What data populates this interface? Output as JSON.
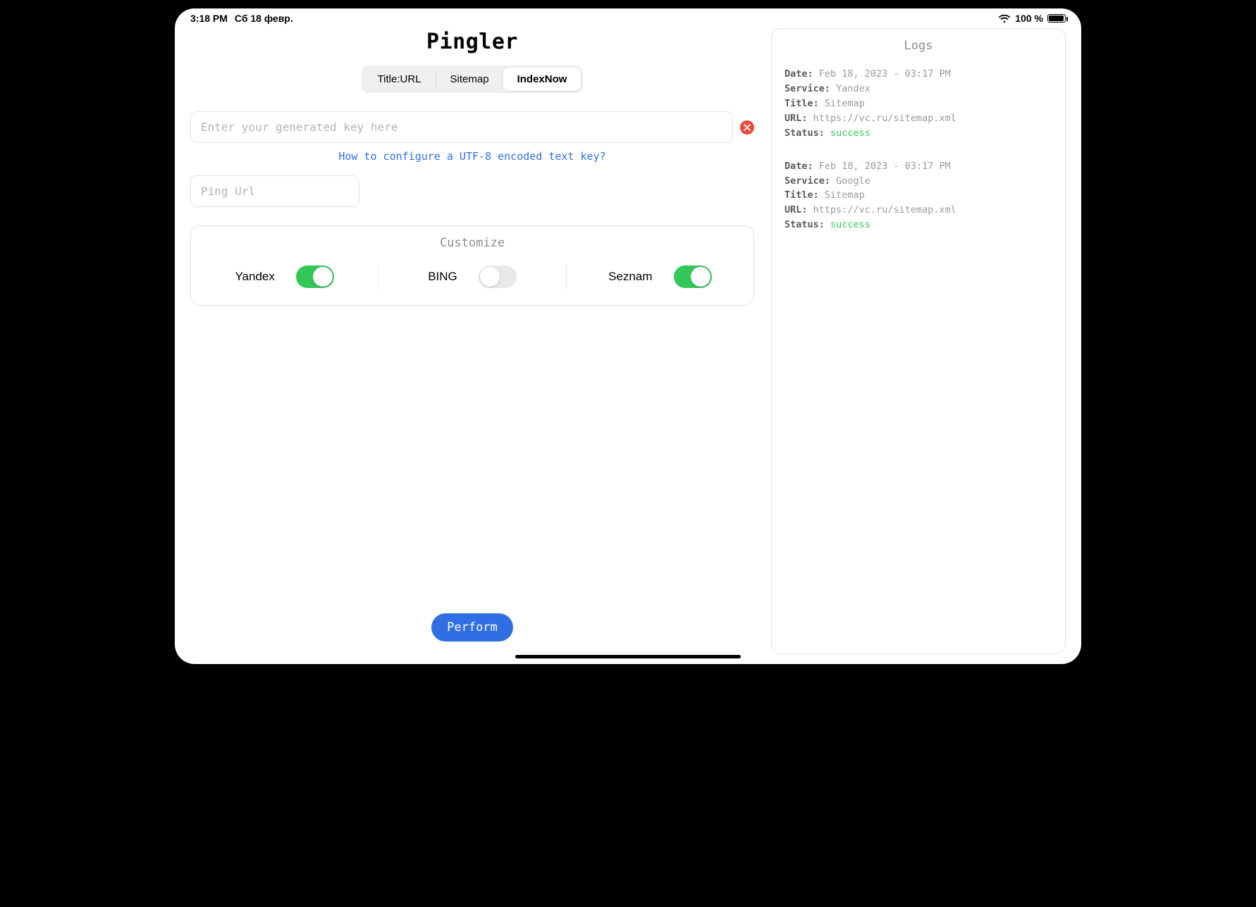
{
  "status_bar": {
    "time": "3:18 PM",
    "date": "Сб 18 февр.",
    "battery_pct": "100 %"
  },
  "app_title": "Pingler",
  "tabs": {
    "items": [
      "Title:URL",
      "Sitemap",
      "IndexNow"
    ],
    "active_index": 2
  },
  "key_input": {
    "value": "",
    "placeholder": "Enter your generated key here"
  },
  "help_link": "How to configure a UTF-8 encoded text key?",
  "url_input": {
    "value": "",
    "placeholder": "Ping Url"
  },
  "customize": {
    "title": "Customize",
    "toggles": [
      {
        "label": "Yandex",
        "on": true
      },
      {
        "label": "BING",
        "on": false
      },
      {
        "label": "Seznam",
        "on": true
      }
    ]
  },
  "perform_label": "Perform",
  "logs": {
    "title": "Logs",
    "field_labels": {
      "date": "Date:",
      "service": "Service:",
      "title": "Title:",
      "url": "URL:",
      "status": "Status:"
    },
    "entries": [
      {
        "date": "Feb 18, 2023 - 03:17 PM",
        "service": "Yandex",
        "title": "Sitemap",
        "url": "https://vc.ru/sitemap.xml",
        "status": "success"
      },
      {
        "date": "Feb 18, 2023 - 03:17 PM",
        "service": "Google",
        "title": "Sitemap",
        "url": "https://vc.ru/sitemap.xml",
        "status": "success"
      }
    ]
  }
}
